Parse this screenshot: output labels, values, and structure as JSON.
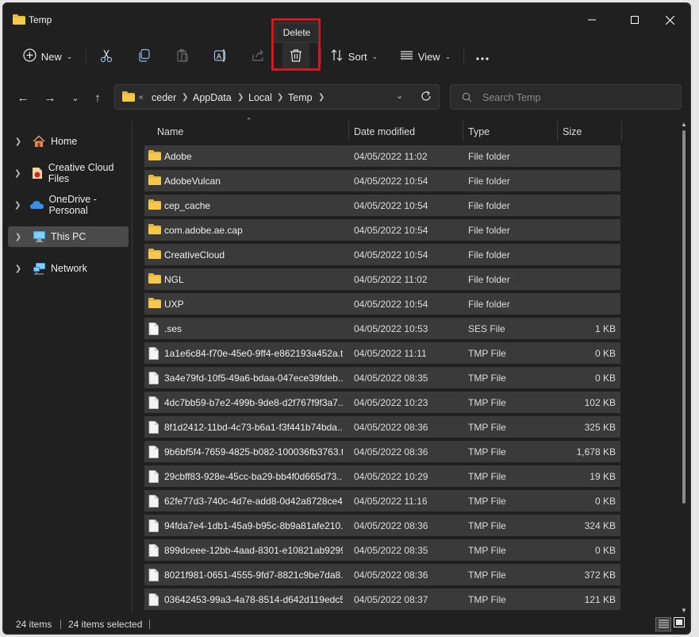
{
  "window": {
    "title": "Temp"
  },
  "toolbar": {
    "new_label": "New",
    "sort_label": "Sort",
    "view_label": "View",
    "delete_tooltip": "Delete"
  },
  "address": {
    "overflow": "«",
    "crumbs": [
      "ceder",
      "AppData",
      "Local",
      "Temp"
    ]
  },
  "search": {
    "placeholder": "Search Temp"
  },
  "sidebar": {
    "items": [
      {
        "label": "Home",
        "icon": "home-icon"
      },
      {
        "label": "Creative Cloud Files",
        "icon": "creative-cloud-icon"
      },
      {
        "label": "OneDrive - Personal",
        "icon": "onedrive-icon"
      },
      {
        "label": "This PC",
        "icon": "computer-icon",
        "selected": true
      },
      {
        "label": "Network",
        "icon": "network-icon"
      }
    ]
  },
  "columns": {
    "name": "Name",
    "date": "Date modified",
    "type": "Type",
    "size": "Size"
  },
  "files": [
    {
      "name": "Adobe",
      "date": "04/05/2022 11:02",
      "type": "File folder",
      "size": "",
      "kind": "folder"
    },
    {
      "name": "AdobeVulcan",
      "date": "04/05/2022 10:54",
      "type": "File folder",
      "size": "",
      "kind": "folder"
    },
    {
      "name": "cep_cache",
      "date": "04/05/2022 10:54",
      "type": "File folder",
      "size": "",
      "kind": "folder"
    },
    {
      "name": "com.adobe.ae.cap",
      "date": "04/05/2022 10:54",
      "type": "File folder",
      "size": "",
      "kind": "folder"
    },
    {
      "name": "CreativeCloud",
      "date": "04/05/2022 10:54",
      "type": "File folder",
      "size": "",
      "kind": "folder"
    },
    {
      "name": "NGL",
      "date": "04/05/2022 11:02",
      "type": "File folder",
      "size": "",
      "kind": "folder"
    },
    {
      "name": "UXP",
      "date": "04/05/2022 10:54",
      "type": "File folder",
      "size": "",
      "kind": "folder"
    },
    {
      "name": ".ses",
      "date": "04/05/2022 10:53",
      "type": "SES File",
      "size": "1 KB",
      "kind": "file"
    },
    {
      "name": "1a1e6c84-f70e-45e0-9ff4-e862193a452a.t...",
      "date": "04/05/2022 11:11",
      "type": "TMP File",
      "size": "0 KB",
      "kind": "file"
    },
    {
      "name": "3a4e79fd-10f5-49a6-bdaa-047ece39fdeb....",
      "date": "04/05/2022 08:35",
      "type": "TMP File",
      "size": "0 KB",
      "kind": "file"
    },
    {
      "name": "4dc7bb59-b7e2-499b-9de8-d2f767f9f3a7....",
      "date": "04/05/2022 10:23",
      "type": "TMP File",
      "size": "102 KB",
      "kind": "file"
    },
    {
      "name": "8f1d2412-11bd-4c73-b6a1-f3f441b74bda....",
      "date": "04/05/2022 08:36",
      "type": "TMP File",
      "size": "325 KB",
      "kind": "file"
    },
    {
      "name": "9b6bf5f4-7659-4825-b082-100036fb3763.t...",
      "date": "04/05/2022 08:36",
      "type": "TMP File",
      "size": "1,678 KB",
      "kind": "file"
    },
    {
      "name": "29cbff83-928e-45cc-ba29-bb4f0d665d73....",
      "date": "04/05/2022 10:29",
      "type": "TMP File",
      "size": "19 KB",
      "kind": "file"
    },
    {
      "name": "62fe77d3-740c-4d7e-add8-0d42a8728ce4....",
      "date": "04/05/2022 11:16",
      "type": "TMP File",
      "size": "0 KB",
      "kind": "file"
    },
    {
      "name": "94fda7e4-1db1-45a9-b95c-8b9a81afe210....",
      "date": "04/05/2022 08:36",
      "type": "TMP File",
      "size": "324 KB",
      "kind": "file"
    },
    {
      "name": "899dceee-12bb-4aad-8301-e10821ab9299....",
      "date": "04/05/2022 08:35",
      "type": "TMP File",
      "size": "0 KB",
      "kind": "file"
    },
    {
      "name": "8021f981-0651-4555-9fd7-8821c9be7da8....",
      "date": "04/05/2022 08:36",
      "type": "TMP File",
      "size": "372 KB",
      "kind": "file"
    },
    {
      "name": "03642453-99a3-4a78-8514-d642d119edc5....",
      "date": "04/05/2022 08:37",
      "type": "TMP File",
      "size": "121 KB",
      "kind": "file"
    }
  ],
  "status": {
    "count": "24 items",
    "selected": "24 items selected"
  },
  "colors": {
    "accent": "#d9141e",
    "folder": "#e8b73a",
    "background": "#202020",
    "row_selected": "#3a3a3a"
  }
}
